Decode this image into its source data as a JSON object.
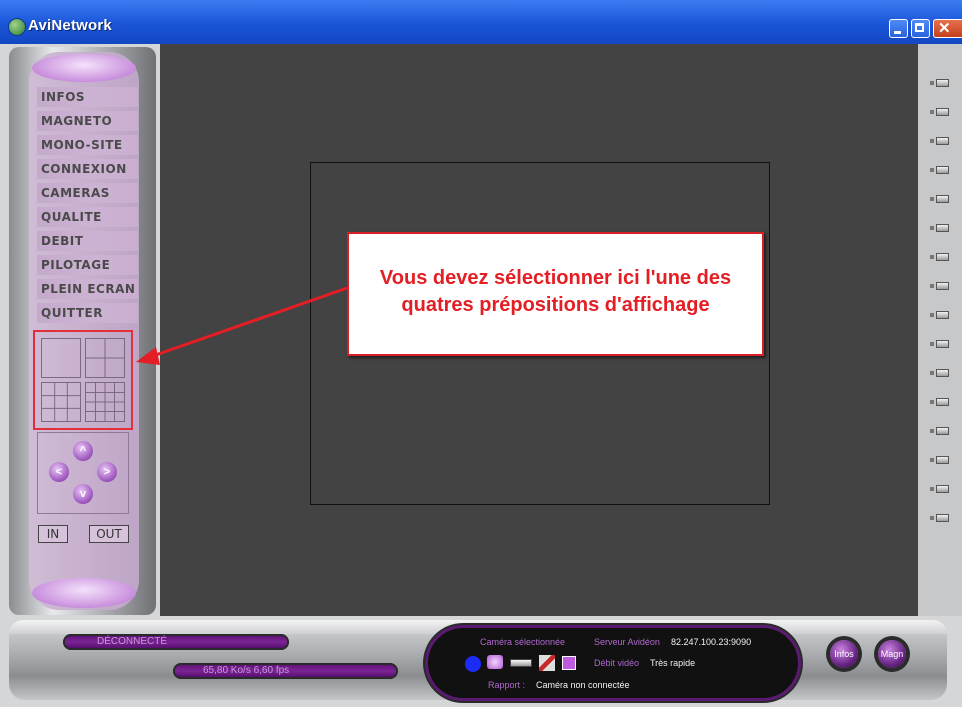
{
  "window": {
    "title": "AviNetwork",
    "close_glyph": "✕"
  },
  "menu": {
    "items": [
      "INFOS",
      "MAGNETO",
      "MONO-SITE",
      "CONNEXION",
      "CAMERAS",
      "QUALITE",
      "DEBIT",
      "PILOTAGE",
      "PLEIN ECRAN",
      "QUITTER"
    ]
  },
  "layouts": [
    {
      "name": "1 caméra",
      "cells": 1
    },
    {
      "name": "4 caméras",
      "cells": 4
    },
    {
      "name": "9 caméras",
      "cells": 9
    },
    {
      "name": "16 caméras",
      "cells": 16
    }
  ],
  "ptz": {
    "up": "^",
    "left": "<",
    "right": ">",
    "down": "v",
    "zoom_in": "IN",
    "zoom_out": "OUT"
  },
  "status": {
    "connection": "DÉCONNECTÉ",
    "throughput": "65,80 Ko/s 6,60 fps"
  },
  "camera_panel": {
    "selected_label": "Caméra sélectionnée",
    "server_label": "Serveur Avidéon",
    "server_value": "82.247.100.23:9090",
    "video_rate_label": "Débit vidéo",
    "video_rate_value": "Très rapide",
    "report_label": "Rapport :",
    "report_value": "Caméra non connectée"
  },
  "buttons": {
    "infos": "Infos",
    "magneto": "Magn"
  },
  "callout": {
    "line1": "Vous devez sélectionner ici l'une des",
    "line2": "quatres prépositions d'affichage"
  },
  "colors": {
    "titlebar": "#1a55d8",
    "video_background": "#434343",
    "menu_accent": "#c98fdd",
    "callout_border": "#d81f26",
    "callout_text": "#e31e24"
  },
  "camera_slots_count": 16
}
